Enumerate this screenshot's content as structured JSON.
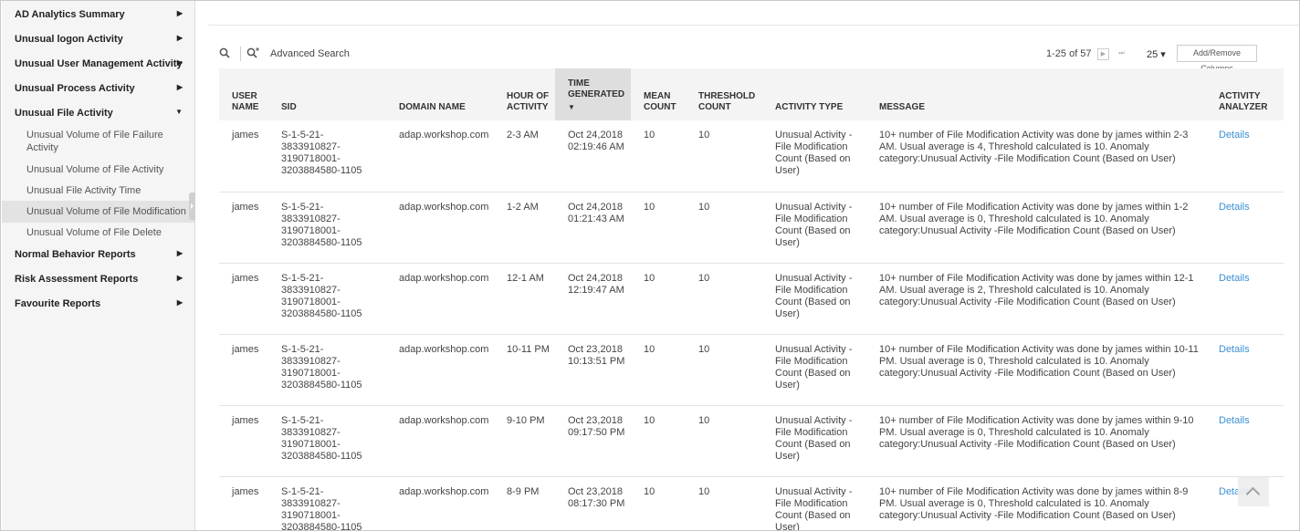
{
  "sidebar": {
    "items": [
      {
        "label": "AD Analytics Summary",
        "arrow": "▶"
      },
      {
        "label": "Unusual logon Activity",
        "arrow": "▶"
      },
      {
        "label": "Unusual User Management Activity",
        "arrow": "▶"
      },
      {
        "label": "Unusual Process Activity",
        "arrow": "▶"
      },
      {
        "label": "Unusual File Activity",
        "arrow": "▼"
      },
      {
        "label": "Normal Behavior Reports",
        "arrow": "▶"
      },
      {
        "label": "Risk Assessment Reports",
        "arrow": "▶"
      },
      {
        "label": "Favourite Reports",
        "arrow": "▶"
      }
    ],
    "subitems": [
      {
        "label": "Unusual Volume of File Failure Activity"
      },
      {
        "label": "Unusual Volume of File Activity"
      },
      {
        "label": "Unusual File Activity Time"
      },
      {
        "label": "Unusual Volume of File Modification"
      },
      {
        "label": "Unusual Volume of File Delete"
      }
    ]
  },
  "toolbar": {
    "search_icon": "search-icon",
    "advanced_search_label": "Advanced Search",
    "pager_text": "1-25 of 57",
    "next_glyph": "▶",
    "last_glyph": "⏭",
    "per_page": "25 ▾",
    "columns_button": "Add/Remove Columns"
  },
  "table": {
    "columns": [
      "USER NAME",
      "SID",
      "DOMAIN NAME",
      "HOUR OF ACTIVITY",
      "TIME GENERATED",
      "MEAN COUNT",
      "THRESHOLD COUNT",
      "ACTIVITY TYPE",
      "MESSAGE",
      "ACTIVITY ANALYZER"
    ],
    "sort_glyph": "▼",
    "rows": [
      {
        "user": "james",
        "sid": "S-1-5-21-3833910827-3190718001-3203884580-1105",
        "domain": "adap.workshop.com",
        "hour": "2-3 AM",
        "time": "Oct 24,2018 02:19:46 AM",
        "mean": "10",
        "threshold": "10",
        "type": "Unusual Activity - File Modification Count (Based on User)",
        "message": "10+ number of File Modification Activity was done by james within 2-3 AM. Usual average is 4, Threshold calculated is 10. Anomaly category:Unusual Activity -File Modification Count (Based on User)",
        "analyzer": "Details"
      },
      {
        "user": "james",
        "sid": "S-1-5-21-3833910827-3190718001-3203884580-1105",
        "domain": "adap.workshop.com",
        "hour": "1-2 AM",
        "time": "Oct 24,2018 01:21:43 AM",
        "mean": "10",
        "threshold": "10",
        "type": "Unusual Activity - File Modification Count (Based on User)",
        "message": "10+ number of File Modification Activity was done by james within 1-2 AM. Usual average is 0, Threshold calculated is 10. Anomaly category:Unusual Activity -File Modification Count (Based on User)",
        "analyzer": "Details"
      },
      {
        "user": "james",
        "sid": "S-1-5-21-3833910827-3190718001-3203884580-1105",
        "domain": "adap.workshop.com",
        "hour": "12-1 AM",
        "time": "Oct 24,2018 12:19:47 AM",
        "mean": "10",
        "threshold": "10",
        "type": "Unusual Activity - File Modification Count (Based on User)",
        "message": "10+ number of File Modification Activity was done by james within 12-1 AM. Usual average is 2, Threshold calculated is 10. Anomaly category:Unusual Activity -File Modification Count (Based on User)",
        "analyzer": "Details"
      },
      {
        "user": "james",
        "sid": "S-1-5-21-3833910827-3190718001-3203884580-1105",
        "domain": "adap.workshop.com",
        "hour": "10-11 PM",
        "time": "Oct 23,2018 10:13:51 PM",
        "mean": "10",
        "threshold": "10",
        "type": "Unusual Activity - File Modification Count (Based on User)",
        "message": "10+ number of File Modification Activity was done by james within 10-11 PM. Usual average is 0, Threshold calculated is 10. Anomaly category:Unusual Activity -File Modification Count (Based on User)",
        "analyzer": "Details"
      },
      {
        "user": "james",
        "sid": "S-1-5-21-3833910827-3190718001-3203884580-1105",
        "domain": "adap.workshop.com",
        "hour": "9-10 PM",
        "time": "Oct 23,2018 09:17:50 PM",
        "mean": "10",
        "threshold": "10",
        "type": "Unusual Activity - File Modification Count (Based on User)",
        "message": "10+ number of File Modification Activity was done by james within 9-10 PM. Usual average is 0, Threshold calculated is 10. Anomaly category:Unusual Activity -File Modification Count (Based on User)",
        "analyzer": "Details"
      },
      {
        "user": "james",
        "sid": "S-1-5-21-3833910827-3190718001-3203884580-1105",
        "domain": "adap.workshop.com",
        "hour": "8-9 PM",
        "time": "Oct 23,2018 08:17:30 PM",
        "mean": "10",
        "threshold": "10",
        "type": "Unusual Activity - File Modification Count (Based on User)",
        "message": "10+ number of File Modification Activity was done by james within 8-9 PM. Usual average is 0, Threshold calculated is 10. Anomaly category:Unusual Activity -File Modification Count (Based on User)",
        "analyzer": "Details"
      }
    ]
  },
  "colors": {
    "link": "#3a8fd5",
    "sidebar_bg": "#f5f5f5",
    "header_bg": "#f4f4f4",
    "sorted_header_bg": "#dedede"
  }
}
